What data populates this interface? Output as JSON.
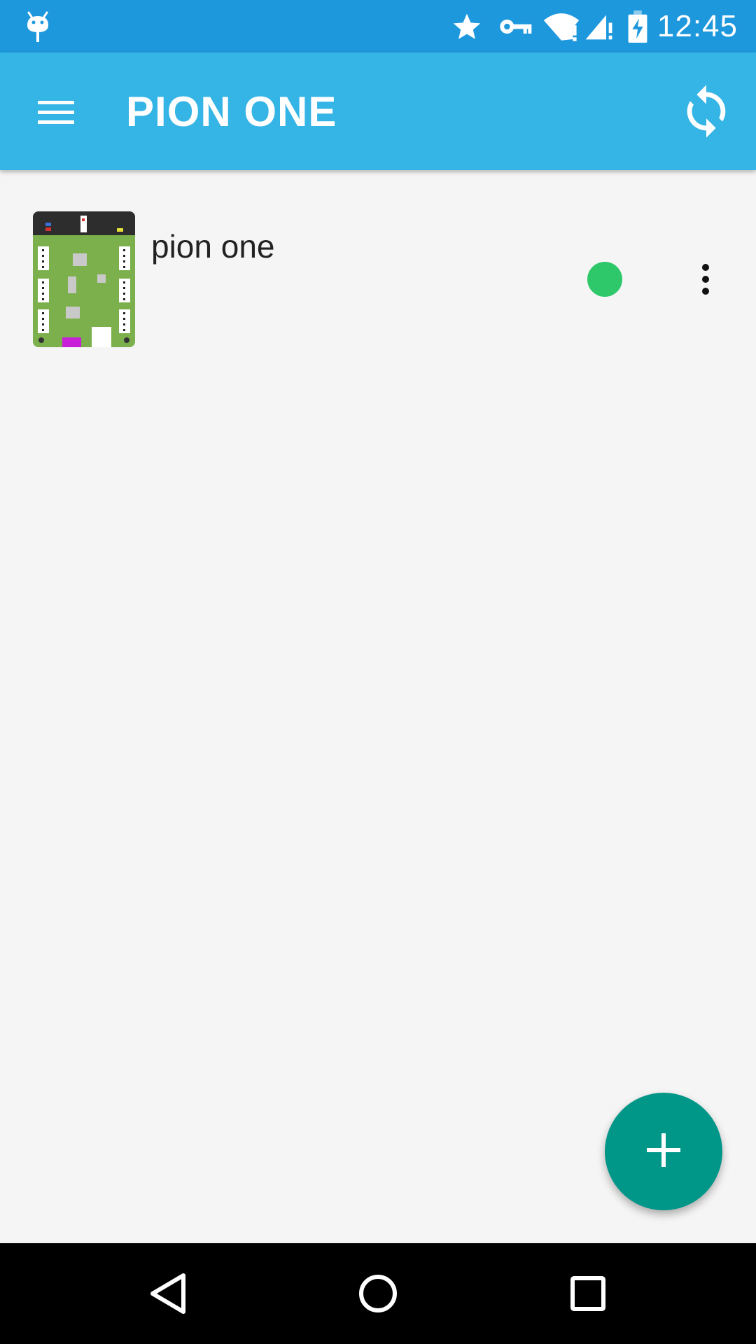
{
  "status_bar": {
    "time": "12:45",
    "icons": [
      "android-debug-icon",
      "star-icon",
      "vpn-key-icon",
      "wifi-alert-icon",
      "signal-alert-icon",
      "battery-charging-icon"
    ]
  },
  "app_bar": {
    "title": "PION ONE",
    "menu_icon": "hamburger-menu-icon",
    "refresh_icon": "sync-icon"
  },
  "devices": [
    {
      "name": "pion one",
      "online": true,
      "status_color": "#2ec76a",
      "thumbnail": "pion-one-board-thumbnail",
      "menu_icon": "more-vert-icon"
    }
  ],
  "fab": {
    "icon": "plus-icon",
    "color": "#009688"
  },
  "nav_bar": {
    "icons": [
      "back-icon",
      "home-icon",
      "recents-icon"
    ]
  },
  "colors": {
    "status_bar": "#1e98dd",
    "app_bar": "#35b4e6",
    "background": "#f5f5f5"
  }
}
